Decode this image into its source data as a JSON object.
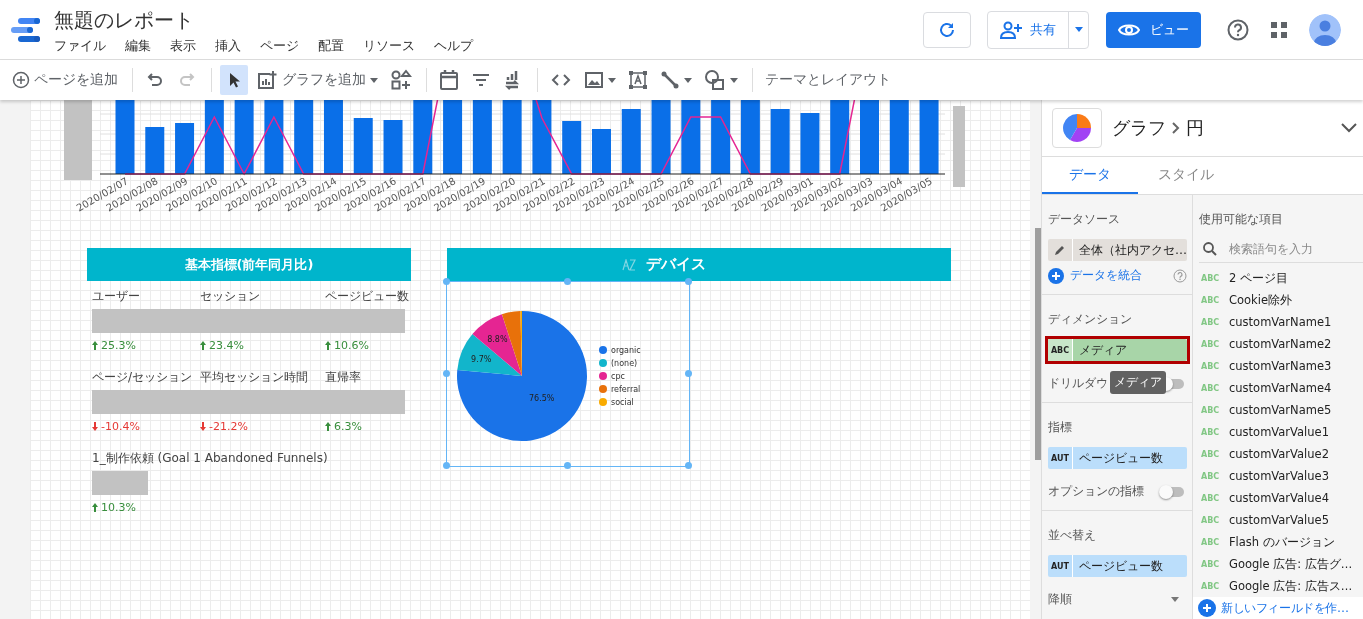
{
  "app": {
    "title": "無題のレポート",
    "menus": [
      "ファイル",
      "編集",
      "表示",
      "挿入",
      "ページ",
      "配置",
      "リソース",
      "ヘルプ"
    ],
    "share": "共有",
    "view": "ビュー"
  },
  "toolbar": [
    {
      "kind": "add_page",
      "label": "ページを追加",
      "selected": false
    },
    {
      "kind": "sep"
    },
    {
      "kind": "undo",
      "selected": false,
      "disabled": false
    },
    {
      "kind": "redo",
      "selected": false,
      "disabled": true
    },
    {
      "kind": "sep"
    },
    {
      "kind": "select",
      "selected": true
    },
    {
      "kind": "add_chart",
      "label": "グラフを追加",
      "selected": false
    },
    {
      "kind": "components",
      "selected": false
    },
    {
      "kind": "sep"
    },
    {
      "kind": "date",
      "selected": false
    },
    {
      "kind": "filter",
      "selected": false
    },
    {
      "kind": "data_control",
      "selected": false
    },
    {
      "kind": "sep"
    },
    {
      "kind": "code",
      "selected": false
    },
    {
      "kind": "image",
      "selected": false
    },
    {
      "kind": "text",
      "selected": false
    },
    {
      "kind": "line",
      "selected": false
    },
    {
      "kind": "shape",
      "selected": false
    },
    {
      "kind": "sep"
    },
    {
      "kind": "theme",
      "label": "テーマとレイアウト",
      "selected": false
    }
  ],
  "top_chart": {
    "x_labels": [
      "2020/02/07",
      "2020/02/08",
      "2020/02/09",
      "2020/02/10",
      "2020/02/11",
      "2020/02/12",
      "2020/02/13",
      "2020/02/14",
      "2020/02/15",
      "2020/02/16",
      "2020/02/17",
      "2020/02/18",
      "2020/02/19",
      "2020/02/20",
      "2020/02/21",
      "2020/02/22",
      "2020/02/23",
      "2020/02/24",
      "2020/02/25",
      "2020/02/26",
      "2020/02/27",
      "2020/02/28",
      "2020/02/29",
      "2020/03/01",
      "2020/03/02",
      "2020/03/03",
      "2020/03/04",
      "2020/03/05"
    ]
  },
  "scorecard": {
    "title": "基本指標(前年同月比)",
    "groups": [
      {
        "metrics": [
          {
            "label": "ユーザー",
            "change": "25.3%",
            "increase": true
          },
          {
            "label": "セッション",
            "change": "23.4%",
            "increase": true
          },
          {
            "label": "ページビュー数",
            "change": "10.6%",
            "increase": true
          }
        ]
      },
      {
        "metrics": [
          {
            "label": "ページ/セッション",
            "change": "-10.4%",
            "increase": false
          },
          {
            "label": "平均セッション時間",
            "change": "-21.2%",
            "increase": false
          },
          {
            "label": "直帰率",
            "change": "6.3%",
            "increase": true
          }
        ]
      },
      {
        "metrics": [
          {
            "label": "1_制作依頼 (Goal 1 Abandoned Funnels)",
            "change": "10.3%",
            "increase": true
          }
        ]
      }
    ]
  },
  "device_chart": {
    "title": "デバイス",
    "selected": true,
    "chart_data": {
      "type": "pie",
      "categories": [
        "organic",
        "(none)",
        "cpc",
        "referral",
        "social"
      ],
      "values": [
        76.5,
        9.7,
        8.8,
        4.6,
        0.4
      ],
      "colors": [
        "#1a73e8",
        "#12b5cb",
        "#e52592",
        "#e8710a",
        "#f9ab00"
      ],
      "value_labels": [
        "76.5%",
        "9.7%",
        "8.8%",
        null,
        null
      ],
      "legend": "right"
    }
  },
  "panel": {
    "type": "グラフ",
    "subtype": "円",
    "tabs": [
      {
        "label": "データ",
        "selected": true
      },
      {
        "label": "スタイル",
        "selected": false
      }
    ],
    "data_source": {
      "heading": "データソース",
      "name": "全体（社内アクセ…",
      "blend": "データを統合"
    },
    "dimension": {
      "heading": "ディメンション",
      "type": "ABC",
      "field": "メディア",
      "highlighted": true
    },
    "drilldown": {
      "label": "ドリルダウ",
      "on": false
    },
    "tooltip": "メディア",
    "metric": {
      "heading": "指標",
      "type": "AUT",
      "field": "ページビュー数"
    },
    "optional_metrics": {
      "label": "オプションの指標",
      "on": false
    },
    "sort": {
      "heading": "並べ替え",
      "type": "AUT",
      "field": "ページビュー数",
      "order": "降順"
    },
    "available": {
      "heading": "使用可能な項目",
      "placeholder": "検索語句を入力",
      "fields": [
        {
          "type": "ABC",
          "name": "2 ページ目"
        },
        {
          "type": "ABC",
          "name": "Cookie除外"
        },
        {
          "type": "ABC",
          "name": "customVarName1"
        },
        {
          "type": "ABC",
          "name": "customVarName2"
        },
        {
          "type": "ABC",
          "name": "customVarName3"
        },
        {
          "type": "ABC",
          "name": "customVarName4"
        },
        {
          "type": "ABC",
          "name": "customVarName5"
        },
        {
          "type": "ABC",
          "name": "customVarValue1"
        },
        {
          "type": "ABC",
          "name": "customVarValue2"
        },
        {
          "type": "ABC",
          "name": "customVarValue3"
        },
        {
          "type": "ABC",
          "name": "customVarValue4"
        },
        {
          "type": "ABC",
          "name": "customVarValue5"
        },
        {
          "type": "ABC",
          "name": "Flash のバージョン"
        },
        {
          "type": "ABC",
          "name": "Google 広告: 広告グ…"
        },
        {
          "type": "ABC",
          "name": "Google 広告: 広告ス…"
        }
      ],
      "create": "新しいフィールドを作…"
    }
  }
}
